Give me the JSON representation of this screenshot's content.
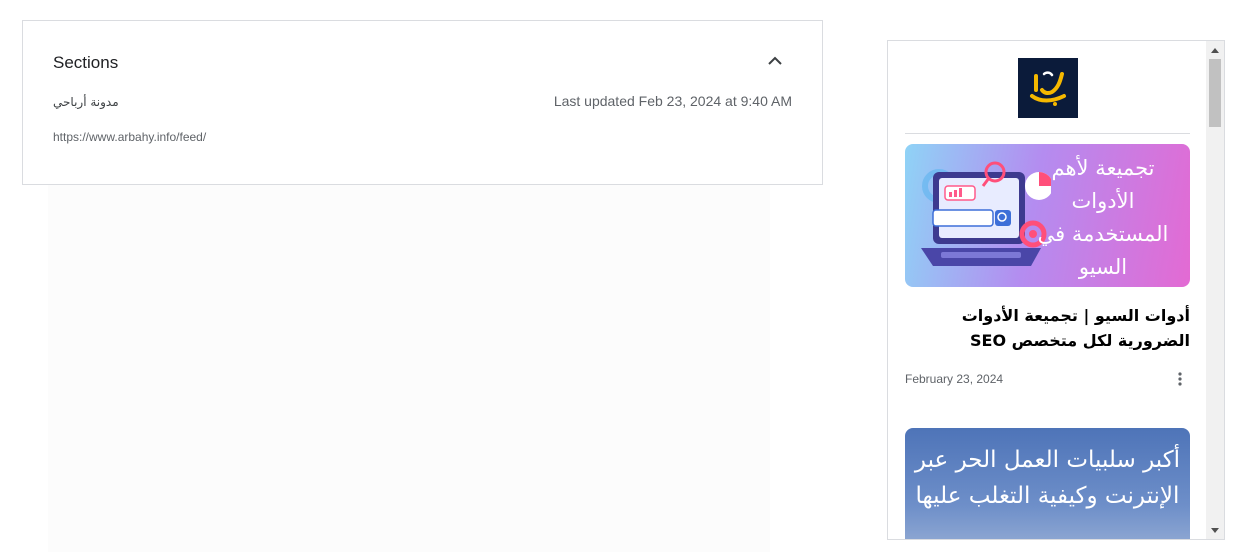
{
  "sections": {
    "title": "Sections",
    "feed_name": "مدونة أرباحي",
    "last_updated": "Last updated Feb 23, 2024 at 9:40 AM",
    "feed_url": "https://www.arbahy.info/feed/",
    "collapse_icon": "chevron-up-icon"
  },
  "preview": {
    "logo_text": "أرباحي",
    "articles": [
      {
        "thumb_text": "تجميعة لأهم الأدوات المستخدمة في السيو",
        "title": "أدوات السيو | تجميعة الأدوات الضرورية لكل متخصص SEO",
        "date": "February 23, 2024",
        "more_icon": "more-vert-icon"
      },
      {
        "thumb_text": "أكبر سلبيات العمل الحر عبر الإنترنت وكيفية التغلب عليها"
      }
    ]
  },
  "colors": {
    "logo_bg": "#0b1b3a",
    "logo_text": "#f5b800",
    "thumb1_gradient": [
      "#8fd3f6",
      "#b48cf0",
      "#e36ad3"
    ],
    "thumb2_gradient": [
      "#4e74b8",
      "#9bb1d6"
    ]
  }
}
